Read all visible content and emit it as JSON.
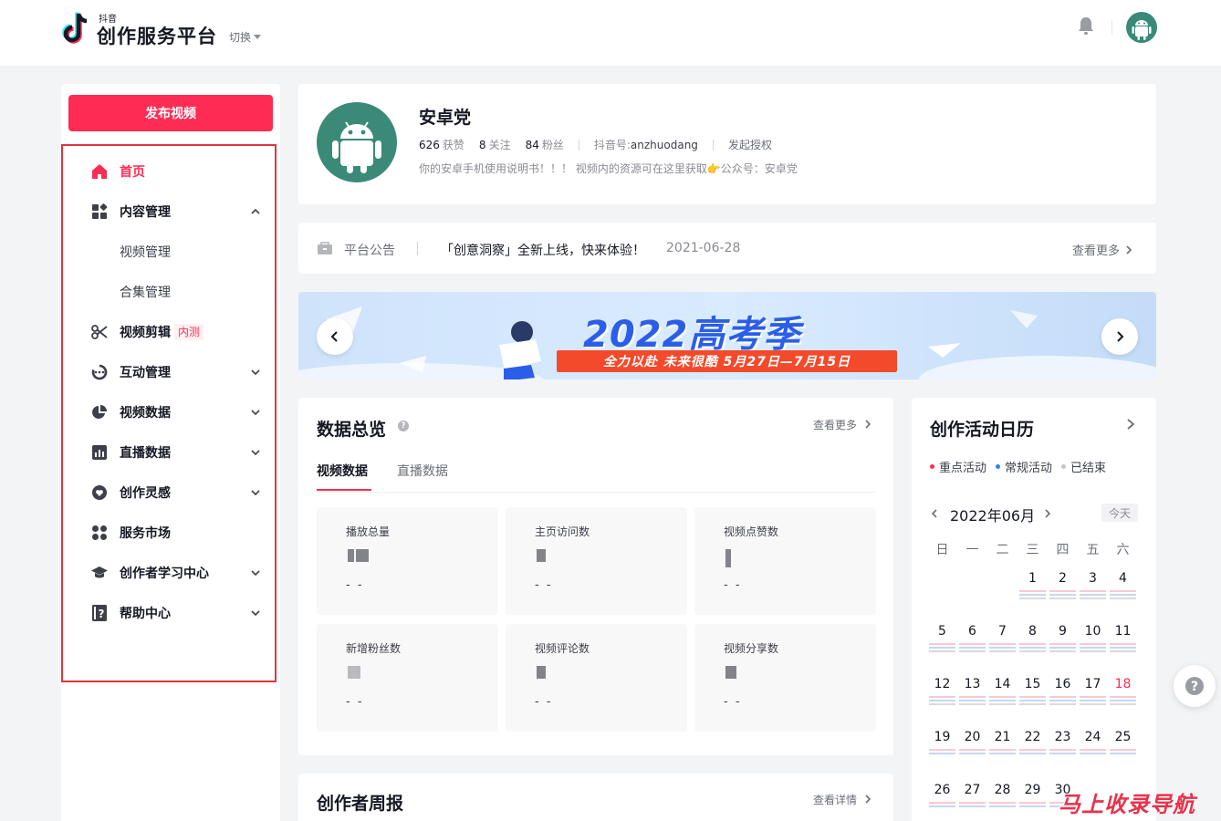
{
  "header": {
    "logo_sub": "抖音",
    "logo_title": "创作服务平台",
    "switch_label": "切换"
  },
  "sidebar": {
    "publish_label": "发布视频",
    "beta_badge": "内测",
    "items": [
      {
        "label": "首页",
        "icon": "home-icon"
      },
      {
        "label": "内容管理",
        "icon": "content-grid-icon"
      },
      {
        "label": "视频管理"
      },
      {
        "label": "合集管理"
      },
      {
        "label": "视频剪辑",
        "icon": "scissors-icon"
      },
      {
        "label": "互动管理",
        "icon": "interaction-icon"
      },
      {
        "label": "视频数据",
        "icon": "pie-chart-icon"
      },
      {
        "label": "直播数据",
        "icon": "bar-chart-icon"
      },
      {
        "label": "创作灵感",
        "icon": "heart-icon"
      },
      {
        "label": "服务市场",
        "icon": "apps-icon"
      },
      {
        "label": "创作者学习中心",
        "icon": "graduation-cap-icon"
      },
      {
        "label": "帮助中心",
        "icon": "help-book-icon"
      }
    ]
  },
  "profile": {
    "name": "安卓党",
    "likes": "626",
    "likes_label": "获赞",
    "following": "8",
    "following_label": "关注",
    "followers": "84",
    "followers_label": "粉丝",
    "douyin_id_label": "抖音号:",
    "douyin_id": "anzhuodang",
    "auth_label": "发起授权",
    "bio": "你的安卓手机使用说明书！！！ 视频内的资源可在这里获取👉公众号：安卓党"
  },
  "announcement": {
    "label": "平台公告",
    "text": "「创意洞察」全新上线，快来体验！",
    "date": "2021-06-28",
    "more": "查看更多"
  },
  "banner": {
    "title": "2022高考季",
    "subtitle": "全力以赴 未来很酷 5月27日—7月15日"
  },
  "overview": {
    "title": "数据总览",
    "more": "查看更多",
    "tabs": [
      "视频数据",
      "直播数据"
    ],
    "metrics": [
      {
        "label": "播放总量",
        "value": "- -"
      },
      {
        "label": "主页访问数",
        "value": "- -"
      },
      {
        "label": "视频点赞数",
        "value": "- -"
      },
      {
        "label": "新增粉丝数",
        "value": "- -"
      },
      {
        "label": "视频评论数",
        "value": "- -"
      },
      {
        "label": "视频分享数",
        "value": "- -"
      }
    ]
  },
  "calendar": {
    "title": "创作活动日历",
    "legend": [
      {
        "label": "重点活动",
        "color": "#fe2c55"
      },
      {
        "label": "常规活动",
        "color": "#1f8cf0"
      },
      {
        "label": "已结束",
        "color": "#c4c5c9"
      }
    ],
    "month": "2022年06月",
    "today_label": "今天",
    "weekdays": [
      "日",
      "一",
      "二",
      "三",
      "四",
      "五",
      "六"
    ],
    "weeks": [
      [
        "",
        "",
        "",
        "1",
        "2",
        "3",
        "4"
      ],
      [
        "5",
        "6",
        "7",
        "8",
        "9",
        "10",
        "11"
      ],
      [
        "12",
        "13",
        "14",
        "15",
        "16",
        "17",
        "18"
      ],
      [
        "19",
        "20",
        "21",
        "22",
        "23",
        "24",
        "25"
      ],
      [
        "26",
        "27",
        "28",
        "29",
        "30",
        "",
        ""
      ]
    ],
    "today": "18"
  },
  "weekly": {
    "title": "创作者周报",
    "more": "查看详情"
  },
  "watermark": "马上收录导航"
}
